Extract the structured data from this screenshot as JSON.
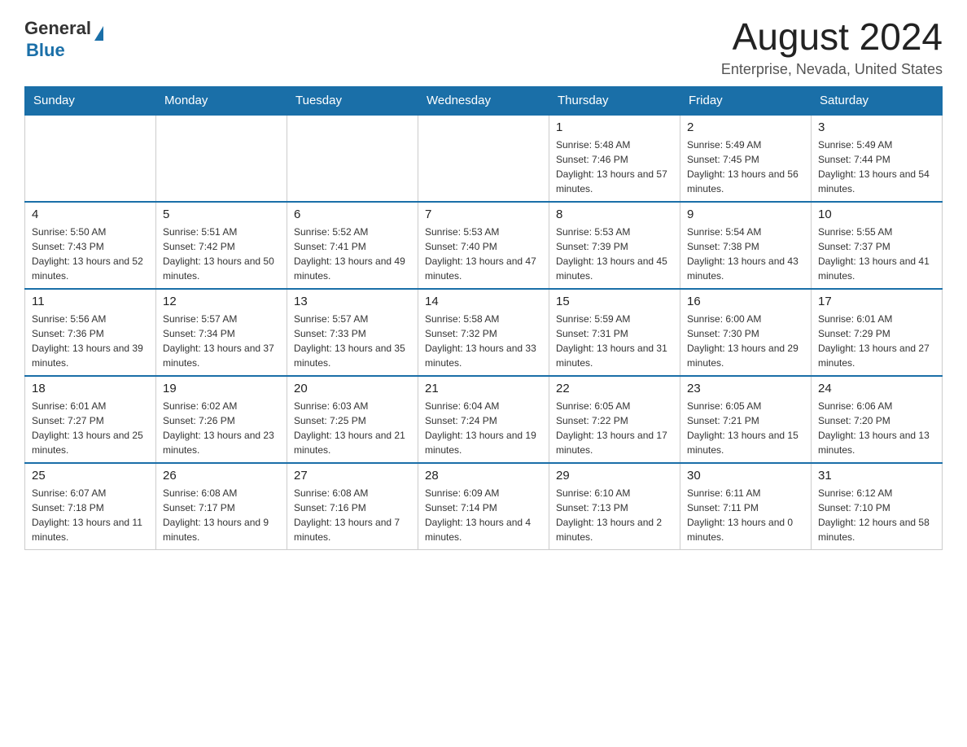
{
  "logo": {
    "text_general": "General",
    "text_blue": "Blue"
  },
  "header": {
    "month_year": "August 2024",
    "location": "Enterprise, Nevada, United States"
  },
  "days_of_week": [
    "Sunday",
    "Monday",
    "Tuesday",
    "Wednesday",
    "Thursday",
    "Friday",
    "Saturday"
  ],
  "weeks": [
    [
      {
        "day": "",
        "sunrise": "",
        "sunset": "",
        "daylight": ""
      },
      {
        "day": "",
        "sunrise": "",
        "sunset": "",
        "daylight": ""
      },
      {
        "day": "",
        "sunrise": "",
        "sunset": "",
        "daylight": ""
      },
      {
        "day": "",
        "sunrise": "",
        "sunset": "",
        "daylight": ""
      },
      {
        "day": "1",
        "sunrise": "Sunrise: 5:48 AM",
        "sunset": "Sunset: 7:46 PM",
        "daylight": "Daylight: 13 hours and 57 minutes."
      },
      {
        "day": "2",
        "sunrise": "Sunrise: 5:49 AM",
        "sunset": "Sunset: 7:45 PM",
        "daylight": "Daylight: 13 hours and 56 minutes."
      },
      {
        "day": "3",
        "sunrise": "Sunrise: 5:49 AM",
        "sunset": "Sunset: 7:44 PM",
        "daylight": "Daylight: 13 hours and 54 minutes."
      }
    ],
    [
      {
        "day": "4",
        "sunrise": "Sunrise: 5:50 AM",
        "sunset": "Sunset: 7:43 PM",
        "daylight": "Daylight: 13 hours and 52 minutes."
      },
      {
        "day": "5",
        "sunrise": "Sunrise: 5:51 AM",
        "sunset": "Sunset: 7:42 PM",
        "daylight": "Daylight: 13 hours and 50 minutes."
      },
      {
        "day": "6",
        "sunrise": "Sunrise: 5:52 AM",
        "sunset": "Sunset: 7:41 PM",
        "daylight": "Daylight: 13 hours and 49 minutes."
      },
      {
        "day": "7",
        "sunrise": "Sunrise: 5:53 AM",
        "sunset": "Sunset: 7:40 PM",
        "daylight": "Daylight: 13 hours and 47 minutes."
      },
      {
        "day": "8",
        "sunrise": "Sunrise: 5:53 AM",
        "sunset": "Sunset: 7:39 PM",
        "daylight": "Daylight: 13 hours and 45 minutes."
      },
      {
        "day": "9",
        "sunrise": "Sunrise: 5:54 AM",
        "sunset": "Sunset: 7:38 PM",
        "daylight": "Daylight: 13 hours and 43 minutes."
      },
      {
        "day": "10",
        "sunrise": "Sunrise: 5:55 AM",
        "sunset": "Sunset: 7:37 PM",
        "daylight": "Daylight: 13 hours and 41 minutes."
      }
    ],
    [
      {
        "day": "11",
        "sunrise": "Sunrise: 5:56 AM",
        "sunset": "Sunset: 7:36 PM",
        "daylight": "Daylight: 13 hours and 39 minutes."
      },
      {
        "day": "12",
        "sunrise": "Sunrise: 5:57 AM",
        "sunset": "Sunset: 7:34 PM",
        "daylight": "Daylight: 13 hours and 37 minutes."
      },
      {
        "day": "13",
        "sunrise": "Sunrise: 5:57 AM",
        "sunset": "Sunset: 7:33 PM",
        "daylight": "Daylight: 13 hours and 35 minutes."
      },
      {
        "day": "14",
        "sunrise": "Sunrise: 5:58 AM",
        "sunset": "Sunset: 7:32 PM",
        "daylight": "Daylight: 13 hours and 33 minutes."
      },
      {
        "day": "15",
        "sunrise": "Sunrise: 5:59 AM",
        "sunset": "Sunset: 7:31 PM",
        "daylight": "Daylight: 13 hours and 31 minutes."
      },
      {
        "day": "16",
        "sunrise": "Sunrise: 6:00 AM",
        "sunset": "Sunset: 7:30 PM",
        "daylight": "Daylight: 13 hours and 29 minutes."
      },
      {
        "day": "17",
        "sunrise": "Sunrise: 6:01 AM",
        "sunset": "Sunset: 7:29 PM",
        "daylight": "Daylight: 13 hours and 27 minutes."
      }
    ],
    [
      {
        "day": "18",
        "sunrise": "Sunrise: 6:01 AM",
        "sunset": "Sunset: 7:27 PM",
        "daylight": "Daylight: 13 hours and 25 minutes."
      },
      {
        "day": "19",
        "sunrise": "Sunrise: 6:02 AM",
        "sunset": "Sunset: 7:26 PM",
        "daylight": "Daylight: 13 hours and 23 minutes."
      },
      {
        "day": "20",
        "sunrise": "Sunrise: 6:03 AM",
        "sunset": "Sunset: 7:25 PM",
        "daylight": "Daylight: 13 hours and 21 minutes."
      },
      {
        "day": "21",
        "sunrise": "Sunrise: 6:04 AM",
        "sunset": "Sunset: 7:24 PM",
        "daylight": "Daylight: 13 hours and 19 minutes."
      },
      {
        "day": "22",
        "sunrise": "Sunrise: 6:05 AM",
        "sunset": "Sunset: 7:22 PM",
        "daylight": "Daylight: 13 hours and 17 minutes."
      },
      {
        "day": "23",
        "sunrise": "Sunrise: 6:05 AM",
        "sunset": "Sunset: 7:21 PM",
        "daylight": "Daylight: 13 hours and 15 minutes."
      },
      {
        "day": "24",
        "sunrise": "Sunrise: 6:06 AM",
        "sunset": "Sunset: 7:20 PM",
        "daylight": "Daylight: 13 hours and 13 minutes."
      }
    ],
    [
      {
        "day": "25",
        "sunrise": "Sunrise: 6:07 AM",
        "sunset": "Sunset: 7:18 PM",
        "daylight": "Daylight: 13 hours and 11 minutes."
      },
      {
        "day": "26",
        "sunrise": "Sunrise: 6:08 AM",
        "sunset": "Sunset: 7:17 PM",
        "daylight": "Daylight: 13 hours and 9 minutes."
      },
      {
        "day": "27",
        "sunrise": "Sunrise: 6:08 AM",
        "sunset": "Sunset: 7:16 PM",
        "daylight": "Daylight: 13 hours and 7 minutes."
      },
      {
        "day": "28",
        "sunrise": "Sunrise: 6:09 AM",
        "sunset": "Sunset: 7:14 PM",
        "daylight": "Daylight: 13 hours and 4 minutes."
      },
      {
        "day": "29",
        "sunrise": "Sunrise: 6:10 AM",
        "sunset": "Sunset: 7:13 PM",
        "daylight": "Daylight: 13 hours and 2 minutes."
      },
      {
        "day": "30",
        "sunrise": "Sunrise: 6:11 AM",
        "sunset": "Sunset: 7:11 PM",
        "daylight": "Daylight: 13 hours and 0 minutes."
      },
      {
        "day": "31",
        "sunrise": "Sunrise: 6:12 AM",
        "sunset": "Sunset: 7:10 PM",
        "daylight": "Daylight: 12 hours and 58 minutes."
      }
    ]
  ]
}
